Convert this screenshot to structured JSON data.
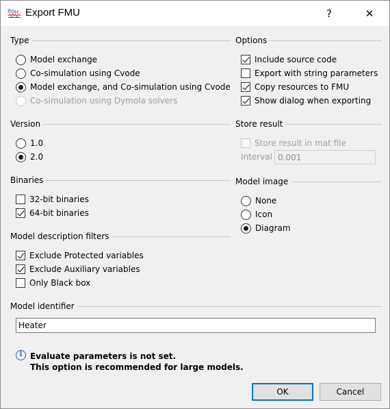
{
  "window": {
    "title": "Export FMU",
    "help_label": "?",
    "close_label": "✕"
  },
  "type": {
    "heading": "Type",
    "options": [
      {
        "label": "Model exchange",
        "checked": false,
        "disabled": false
      },
      {
        "label": "Co-simulation using Cvode",
        "checked": false,
        "disabled": false
      },
      {
        "label": "Model exchange, and Co-simulation using Cvode",
        "checked": true,
        "disabled": false
      },
      {
        "label": "Co-simulation using Dymola solvers",
        "checked": false,
        "disabled": true
      }
    ]
  },
  "options": {
    "heading": "Options",
    "items": [
      {
        "label": "Include source code",
        "checked": true
      },
      {
        "label": "Export with string parameters",
        "checked": false
      },
      {
        "label": "Copy resources to FMU",
        "checked": true
      },
      {
        "label": "Show dialog when exporting",
        "checked": true
      }
    ]
  },
  "version": {
    "heading": "Version",
    "options": [
      {
        "label": "1.0",
        "checked": false
      },
      {
        "label": "2.0",
        "checked": true
      }
    ]
  },
  "store_result": {
    "heading": "Store result",
    "checkbox_label": "Store result in mat file",
    "checked": false,
    "disabled": true,
    "interval_label": "Interval",
    "interval_value": "0.001"
  },
  "binaries": {
    "heading": "Binaries",
    "items": [
      {
        "label": "32-bit binaries",
        "checked": false
      },
      {
        "label": "64-bit binaries",
        "checked": true
      }
    ]
  },
  "model_image": {
    "heading": "Model image",
    "options": [
      {
        "label": "None",
        "checked": false
      },
      {
        "label": "Icon",
        "checked": false
      },
      {
        "label": "Diagram",
        "checked": true
      }
    ]
  },
  "filters": {
    "heading": "Model description filters",
    "items": [
      {
        "label": "Exclude Protected variables",
        "checked": true
      },
      {
        "label": "Exclude Auxiliary variables",
        "checked": true
      },
      {
        "label": "Only Black box",
        "checked": false
      }
    ]
  },
  "identifier": {
    "heading": "Model identifier",
    "value": "Heater"
  },
  "info": {
    "icon": "info-icon",
    "line1": "Evaluate parameters is not set.",
    "line2": "This option is recommended for large models."
  },
  "buttons": {
    "ok": "OK",
    "cancel": "Cancel"
  },
  "colors": {
    "accent": "#0078d7",
    "info": "#2a5fa8"
  }
}
